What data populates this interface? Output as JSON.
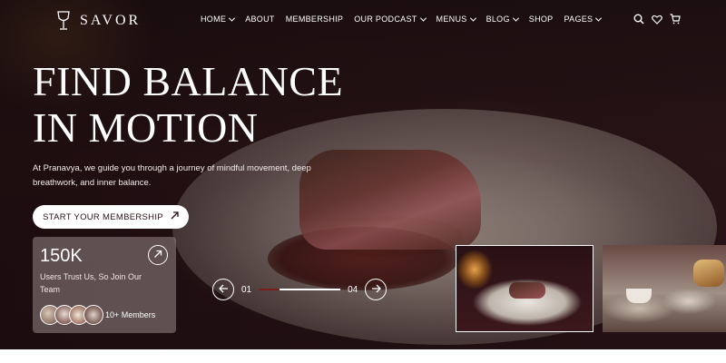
{
  "brand": {
    "name": "SAVOR",
    "logo_icon": "wine-glass-icon"
  },
  "nav": [
    {
      "label": "HOME",
      "dropdown": true
    },
    {
      "label": "ABOUT",
      "dropdown": false
    },
    {
      "label": "MEMBERSHIP",
      "dropdown": false
    },
    {
      "label": "OUR PODCAST",
      "dropdown": true
    },
    {
      "label": "MENUS",
      "dropdown": true
    },
    {
      "label": "BLOG",
      "dropdown": true
    },
    {
      "label": "SHOP",
      "dropdown": false
    },
    {
      "label": "PAGES",
      "dropdown": true
    }
  ],
  "header_icons": [
    "search-icon",
    "heart-icon",
    "cart-icon"
  ],
  "hero": {
    "headline_line1": "FIND BALANCE",
    "headline_line2": "IN MOTION",
    "subtext": "At Pranavya, we guide you through a journey of mindful movement, deep breathwork, and inner balance.",
    "cta_label": "START YOUR MEMBERSHIP"
  },
  "stats": {
    "number": "150K",
    "description": "Users Trust Us, So Join Our Team",
    "members_label": "10+ Members",
    "avatar_count": 4
  },
  "slider": {
    "current": "01",
    "total": "04",
    "progress_fraction": 0.25
  },
  "thumbnails": [
    {
      "name": "steak-dish",
      "active": true
    },
    {
      "name": "coffee-pastries",
      "active": false
    }
  ],
  "colors": {
    "accent": "#7b1e1e",
    "background_dark": "#241115",
    "text": "#ffffff"
  }
}
